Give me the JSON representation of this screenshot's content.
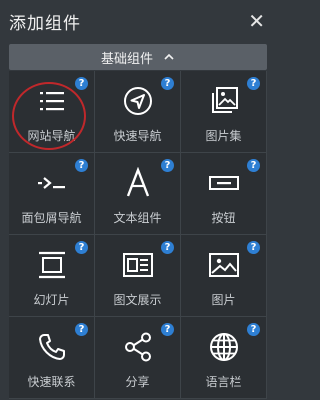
{
  "dialog": {
    "title": "添加组件",
    "close_icon": "close-icon"
  },
  "section": {
    "label": "基础组件",
    "icon": "chevron-up-icon"
  },
  "help_mark": "?",
  "tiles": [
    {
      "label": "网站导航",
      "icon": "list-icon",
      "highlighted": true
    },
    {
      "label": "快速导航",
      "icon": "navigation-arrow-icon"
    },
    {
      "label": "图片集",
      "icon": "image-gallery-icon"
    },
    {
      "label": "面包屑导航",
      "icon": "breadcrumb-icon"
    },
    {
      "label": "文本组件",
      "icon": "text-icon"
    },
    {
      "label": "按钮",
      "icon": "button-icon"
    },
    {
      "label": "幻灯片",
      "icon": "slideshow-icon"
    },
    {
      "label": "图文展示",
      "icon": "image-text-icon"
    },
    {
      "label": "图片",
      "icon": "image-icon"
    },
    {
      "label": "快速联系",
      "icon": "phone-icon"
    },
    {
      "label": "分享",
      "icon": "share-icon"
    },
    {
      "label": "语言栏",
      "icon": "globe-icon"
    }
  ],
  "colors": {
    "accent": "#2e7fd3",
    "highlight_ring": "#c0282b",
    "tile_bg": "#2b2f33"
  }
}
